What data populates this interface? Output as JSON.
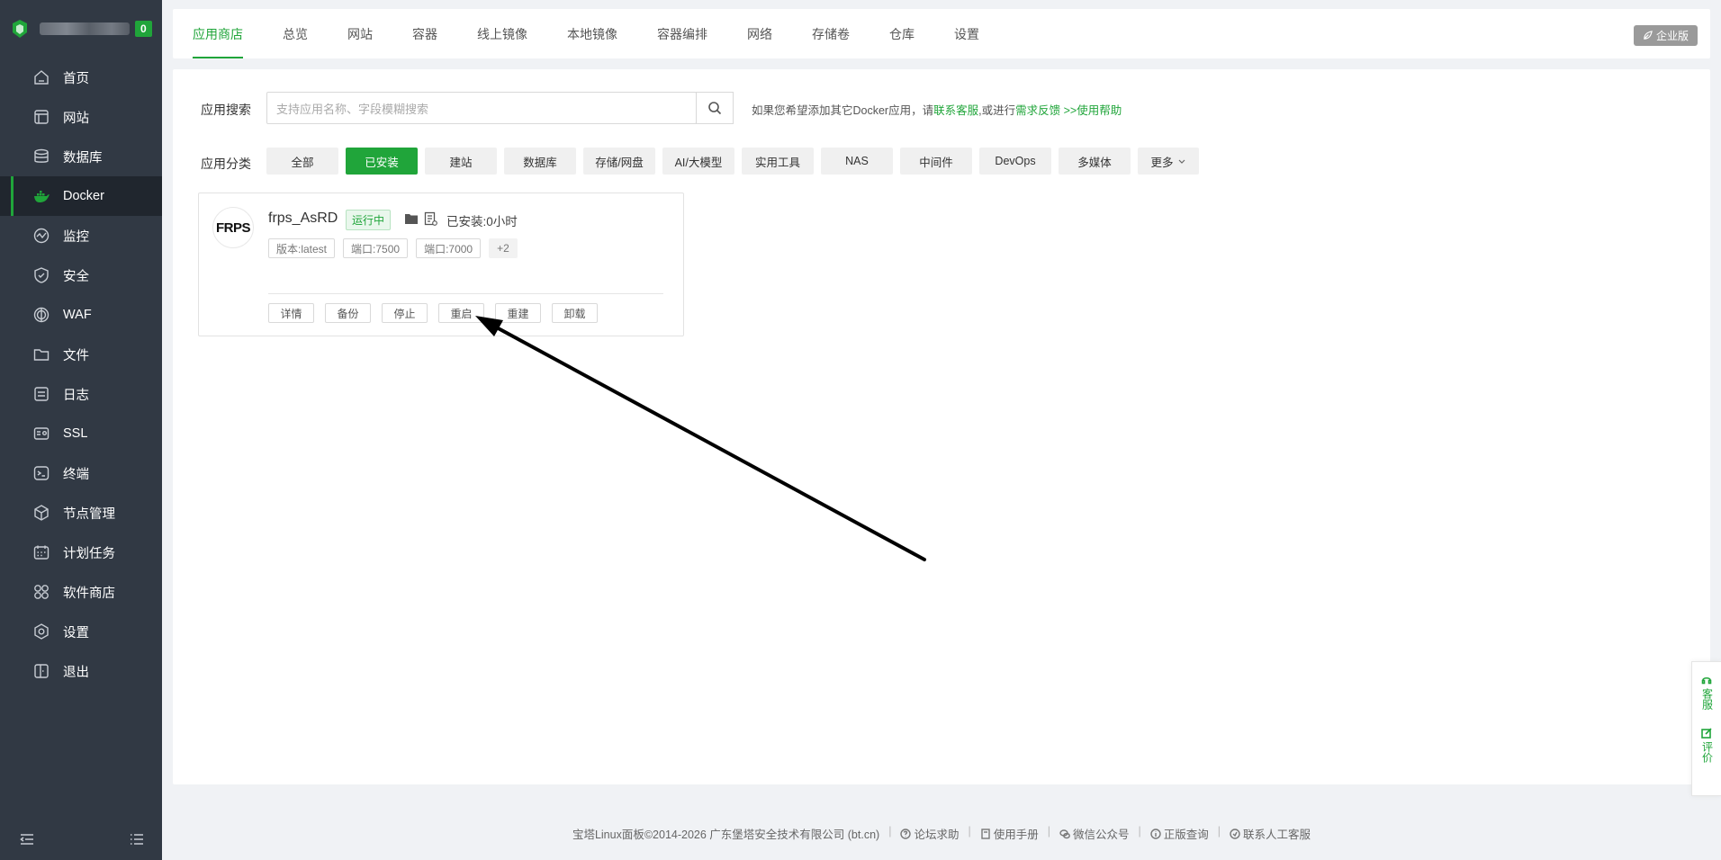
{
  "sidebar": {
    "count_badge": "0",
    "items": [
      {
        "label": "首页",
        "icon": "home-icon"
      },
      {
        "label": "网站",
        "icon": "website-icon"
      },
      {
        "label": "数据库",
        "icon": "database-icon"
      },
      {
        "label": "Docker",
        "icon": "docker-icon",
        "active": true
      },
      {
        "label": "监控",
        "icon": "monitor-icon"
      },
      {
        "label": "安全",
        "icon": "shield-icon"
      },
      {
        "label": "WAF",
        "icon": "waf-icon"
      },
      {
        "label": "文件",
        "icon": "folder-icon"
      },
      {
        "label": "日志",
        "icon": "log-icon"
      },
      {
        "label": "SSL",
        "icon": "ssl-icon"
      },
      {
        "label": "终端",
        "icon": "terminal-icon"
      },
      {
        "label": "节点管理",
        "icon": "node-icon"
      },
      {
        "label": "计划任务",
        "icon": "calendar-icon"
      },
      {
        "label": "软件商店",
        "icon": "apps-icon"
      },
      {
        "label": "设置",
        "icon": "gear-icon"
      },
      {
        "label": "退出",
        "icon": "logout-icon"
      }
    ]
  },
  "tabs": [
    "应用商店",
    "总览",
    "网站",
    "容器",
    "线上镜像",
    "本地镜像",
    "容器编排",
    "网络",
    "存储卷",
    "仓库",
    "设置"
  ],
  "enterprise_label": "企业版",
  "search": {
    "label": "应用搜索",
    "placeholder": "支持应用名称、字段模糊搜索",
    "hint_prefix": "如果您希望添加其它Docker应用，请",
    "hint_link1": "联系客服",
    "hint_mid": ",或进行",
    "hint_link2": "需求反馈",
    "hint_link3": " >>使用帮助"
  },
  "categories": {
    "label": "应用分类",
    "items": [
      "全部",
      "已安装",
      "建站",
      "数据库",
      "存储/网盘",
      "AI/大模型",
      "实用工具",
      "NAS",
      "中间件",
      "DevOps",
      "多媒体",
      "更多"
    ]
  },
  "app": {
    "logo_text": "FRPS",
    "name": "frps_AsRD",
    "status": "运行中",
    "installed": "已安装:0小时",
    "tags": [
      "版本:latest",
      "端口:7500",
      "端口:7000",
      "+2"
    ],
    "actions": [
      "详情",
      "备份",
      "停止",
      "重启",
      "重建",
      "卸载"
    ]
  },
  "float": {
    "service": "客服",
    "review": "评价"
  },
  "footer": {
    "copyright": "宝塔Linux面板©2014-2026 广东堡塔安全技术有限公司 (bt.cn)",
    "links": [
      "论坛求助",
      "使用手册",
      "微信公众号",
      "正版查询",
      "联系人工客服"
    ]
  },
  "colors": {
    "accent": "#20a53a",
    "sidebar_bg": "#313944"
  }
}
